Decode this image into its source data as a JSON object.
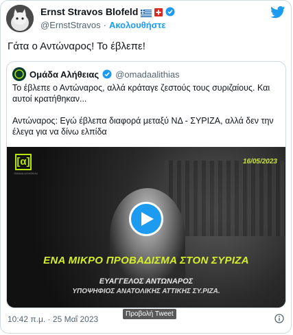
{
  "author": {
    "name": "Ernst Stravos Blofeld",
    "handle": "@ErnstStravos",
    "separator": "·",
    "follow_label": "Ακολουθήστε"
  },
  "tweet": {
    "text": "Γάτα ο Αντώναρος! Το έβλεπε!"
  },
  "quote": {
    "name": "Ομάδα Αλήθειας",
    "handle": "@omadaalithias",
    "line1": "Το έβλεπε ο Αντώναρος, αλλά κράταγε ζεστούς τους συριζαίους. Και αυτοί κρατήθηκαν...",
    "line2": "Αντώναρος: Εγώ έβλεπα διαφορά μεταξύ ΝΔ - ΣΥΡΙΖΑ, αλλά δεν την έλεγα για να δίνω ελπίδα"
  },
  "video": {
    "logo_text": "[α]",
    "logo_sub": "ΟΜΑΔΑ ΑΛΗΘΕΙΑΣ",
    "date": "16/05/2023",
    "caption": "ΕΝΑ ΜΙΚΡΟ ΠΡΟΒΑΔΙΣΜΑ ΣΤΟΝ ΣΥΡΙΖΑ",
    "lower_name": "ΕΥΑΓΓΕΛΟΣ ΑΝΤΩΝΑΡΟΣ",
    "lower_title": "ΥΠΟΨΗΦΙΟΣ ΑΝΑΤΟΛΙΚΗΣ ΑΤΤΙΚΗΣ ΣΥ.ΡΙΖΑ."
  },
  "tooltip": "Προβολή Tweet",
  "timestamp": "10:42 π.μ. · 25 Μαΐ 2023",
  "colors": {
    "accent": "#1d9bf0",
    "caption": "#d4ef2a"
  },
  "icons": [
    "avatar-cat",
    "flag-greece-icon",
    "flag-switzerland-icon",
    "verified-icon",
    "twitter-bird-icon",
    "play-icon",
    "info-icon"
  ]
}
